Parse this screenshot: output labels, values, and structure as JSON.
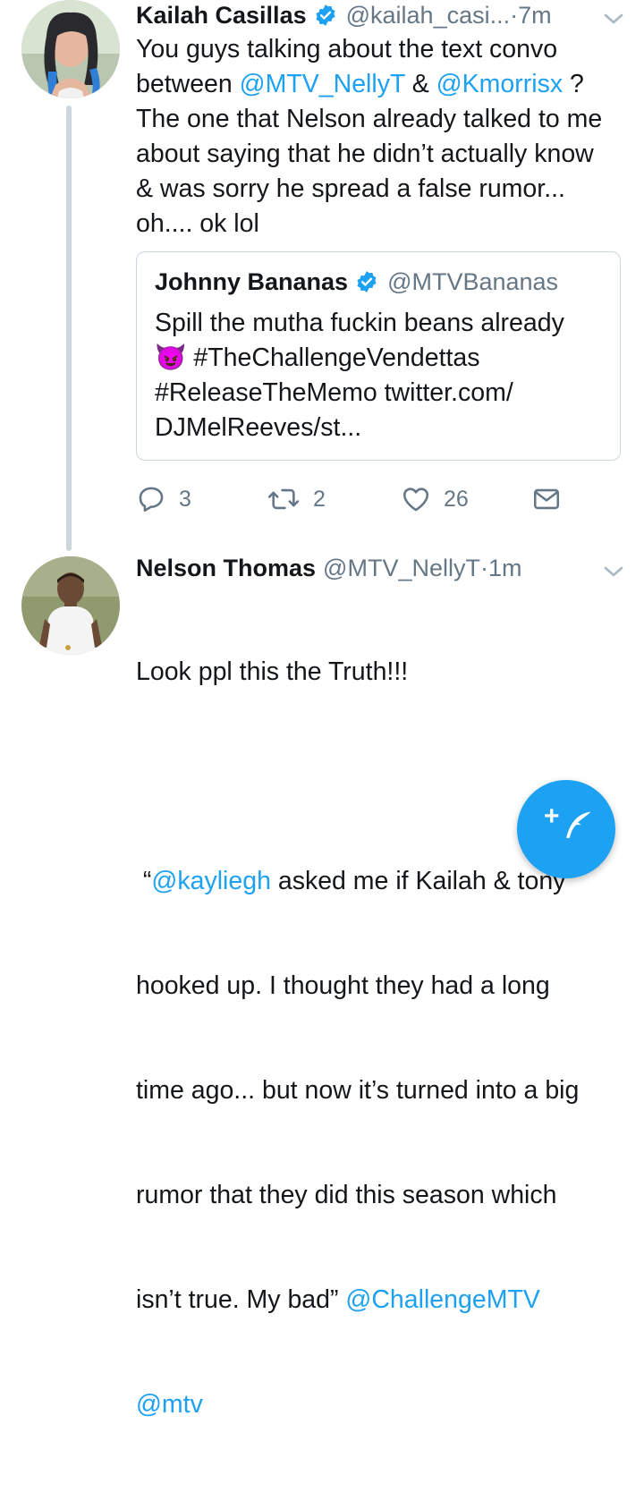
{
  "tweets": [
    {
      "name": "Kailah Casillas",
      "handle": "@kailah_casi...",
      "time": "7m",
      "body_parts": [
        "You guys talking about the text convo\nbetween ",
        "@MTV_NellyT",
        " & ",
        "@Kmorrisx",
        " ?\nThe one that Nelson already talked to me\nabout saying that he didn’t actually know\n& was sorry he spread a false rumor...\noh.... ok lol"
      ],
      "quote": {
        "name": "Johnny Bananas",
        "handle": "@MTVBananas",
        "emoji": "😈",
        "line1": "Spill the mutha fuckin beans already",
        "line2": " #TheChallengeVendettas",
        "line3": "#ReleaseTheMemo twitter.com/",
        "line4": "DJMelReeves/st..."
      },
      "actions": {
        "replies": "3",
        "retweets": "2",
        "likes": "26"
      }
    },
    {
      "name": "Nelson Thomas",
      "handle": "@MTV_NellyT",
      "time": "1m",
      "line1": "Look ppl this the Truth!!!",
      "line2_pre": " “",
      "line2_mention": "@kayliegh",
      "line2_post": " asked me if Kailah & tony",
      "line3": "hooked up. I thought they had a long",
      "line4": "time ago... but now it’s turned into a big",
      "line5": "rumor that they did this season which",
      "line6_pre": "isn’t true. My bad” ",
      "line6_mention": "@ChallengeMTV",
      "line7_mention": "@mtv"
    }
  ],
  "separator": " · ",
  "fab_label": "+",
  "colors": {
    "accent": "#1da1f2",
    "secondary": "#657786",
    "text": "#14171a"
  }
}
